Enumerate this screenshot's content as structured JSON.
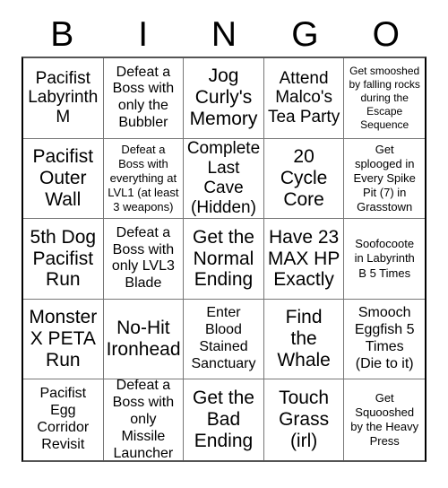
{
  "card": {
    "title": "BINGO",
    "header_letters": [
      "B",
      "I",
      "N",
      "G",
      "O"
    ],
    "columns": 5,
    "rows": 5,
    "colors": {
      "background": "#ffffff",
      "text": "#000000",
      "grid_line": "#777777",
      "grid_border": "#000000"
    },
    "cells": [
      {
        "text": "Pacifist\nLabyrinth\nM",
        "size": "lg",
        "marked": false
      },
      {
        "text": "Defeat a\nBoss with\nonly the\nBubbler",
        "size": "md",
        "marked": false
      },
      {
        "text": "Jog\nCurly's\nMemory",
        "size": "xl",
        "marked": false
      },
      {
        "text": "Attend\nMalco's\nTea Party",
        "size": "lg",
        "marked": false
      },
      {
        "text": "Get smooshed\nby falling rocks\nduring the\nEscape\nSequence",
        "size": "xs",
        "marked": false
      },
      {
        "text": "Pacifist\nOuter\nWall",
        "size": "xl",
        "marked": false
      },
      {
        "text": "Defeat a\nBoss with\neverything at\nLVL1 (at least\n3 weapons)",
        "size": "sm",
        "marked": false
      },
      {
        "text": "Complete\nLast Cave\n(Hidden)",
        "size": "lg",
        "marked": false
      },
      {
        "text": "20\nCycle\nCore",
        "size": "xl",
        "marked": false
      },
      {
        "text": "Get\nsplooged in\nEvery Spike\nPit (7) in\nGrasstown",
        "size": "sm",
        "marked": false
      },
      {
        "text": "5th Dog\nPacifist\nRun",
        "size": "xl",
        "marked": false
      },
      {
        "text": "Defeat a\nBoss with\nonly LVL3\nBlade",
        "size": "md",
        "marked": false
      },
      {
        "text": "Get the\nNormal\nEnding",
        "size": "xl",
        "marked": false
      },
      {
        "text": "Have 23\nMAX HP\nExactly",
        "size": "xl",
        "marked": false
      },
      {
        "text": "Soofocoote\nin Labyrinth\nB 5 Times",
        "size": "sm",
        "marked": false
      },
      {
        "text": "Monster\nX PETA\nRun",
        "size": "xl",
        "marked": false
      },
      {
        "text": "No-Hit\nIronhead",
        "size": "xl",
        "marked": false
      },
      {
        "text": "Enter\nBlood\nStained\nSanctuary",
        "size": "md",
        "marked": false
      },
      {
        "text": "Find\nthe\nWhale",
        "size": "xl",
        "marked": false
      },
      {
        "text": "Smooch\nEggfish 5\nTimes\n(Die to it)",
        "size": "md",
        "marked": false
      },
      {
        "text": "Pacifist\nEgg\nCorridor\nRevisit",
        "size": "md",
        "marked": false
      },
      {
        "text": "Defeat a\nBoss with\nonly Missile\nLauncher",
        "size": "md",
        "marked": false
      },
      {
        "text": "Get the\nBad\nEnding",
        "size": "xl",
        "marked": false
      },
      {
        "text": "Touch\nGrass\n(irl)",
        "size": "xl",
        "marked": false
      },
      {
        "text": "Get\nSquooshed\nby the Heavy\nPress",
        "size": "sm",
        "marked": false
      }
    ]
  }
}
